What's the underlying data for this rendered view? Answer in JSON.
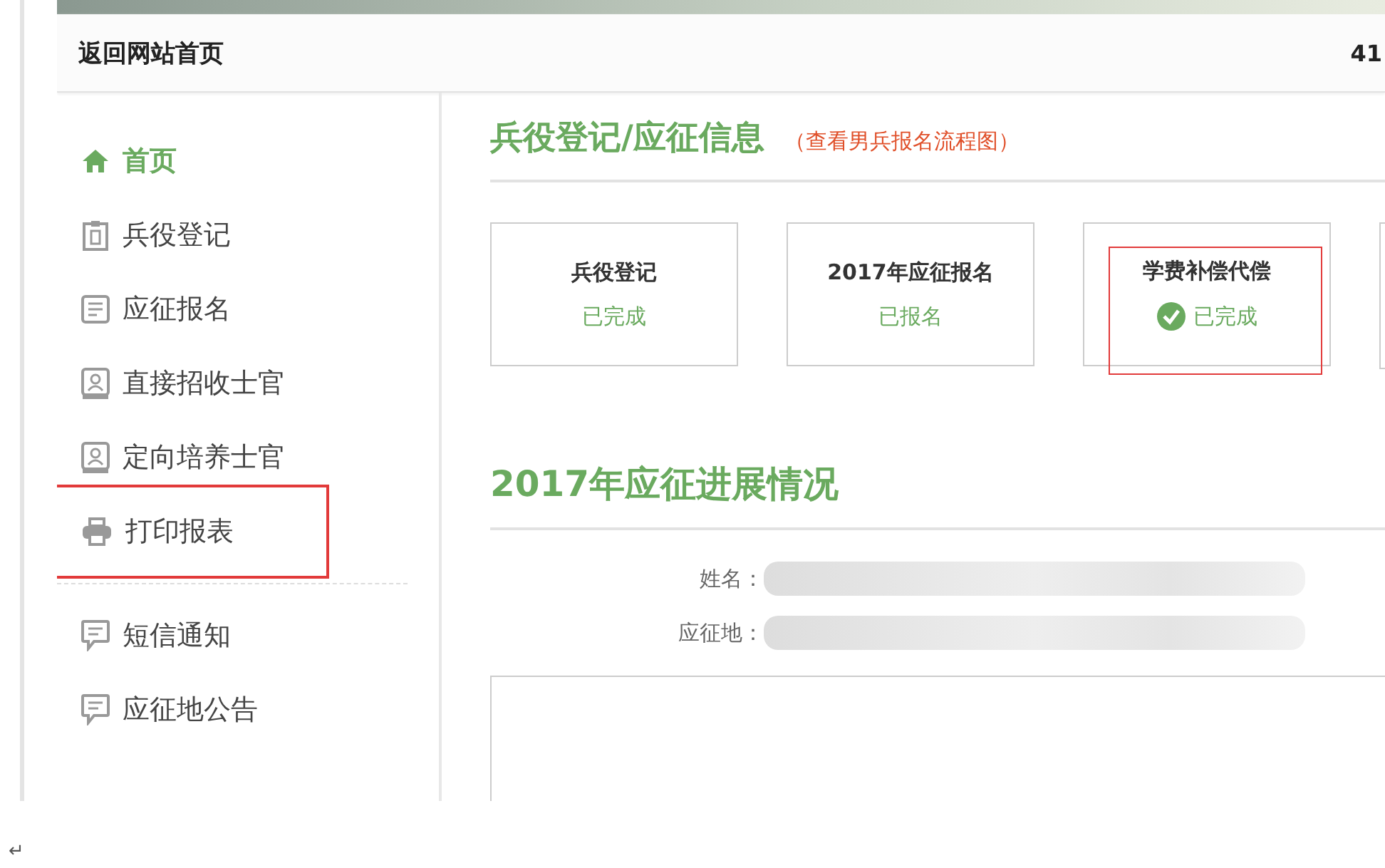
{
  "header": {
    "back_link": "返回网站首页",
    "right_text": "41"
  },
  "sidebar": {
    "items": [
      {
        "label": "首页",
        "kind": "home",
        "selected": true,
        "highlighted": false
      },
      {
        "label": "兵役登记",
        "kind": "clipboard",
        "selected": false,
        "highlighted": false
      },
      {
        "label": "应征报名",
        "kind": "form",
        "selected": false,
        "highlighted": false
      },
      {
        "label": "直接招收士官",
        "kind": "badge",
        "selected": false,
        "highlighted": false
      },
      {
        "label": "定向培养士官",
        "kind": "badge",
        "selected": false,
        "highlighted": false
      },
      {
        "label": "打印报表",
        "kind": "printer",
        "selected": false,
        "highlighted": true
      }
    ],
    "items_2": [
      {
        "label": "短信通知",
        "kind": "message",
        "selected": false,
        "highlighted": false
      },
      {
        "label": "应征地公告",
        "kind": "message",
        "selected": false,
        "highlighted": false
      }
    ]
  },
  "info": {
    "title": "兵役登记/应征信息",
    "link": "（查看男兵报名流程图）",
    "cards": [
      {
        "title": "兵役登记",
        "status": "已完成",
        "checked": false,
        "highlighted": false
      },
      {
        "title": "2017年应征报名",
        "status": "已报名",
        "checked": false,
        "highlighted": false
      },
      {
        "title": "学费补偿代偿",
        "status": "已完成",
        "checked": true,
        "highlighted": true
      }
    ]
  },
  "progress": {
    "title": "2017年应征进展情况",
    "fields": [
      {
        "label": "姓名："
      },
      {
        "label": "应征地："
      }
    ]
  },
  "footer_mark": "↵"
}
